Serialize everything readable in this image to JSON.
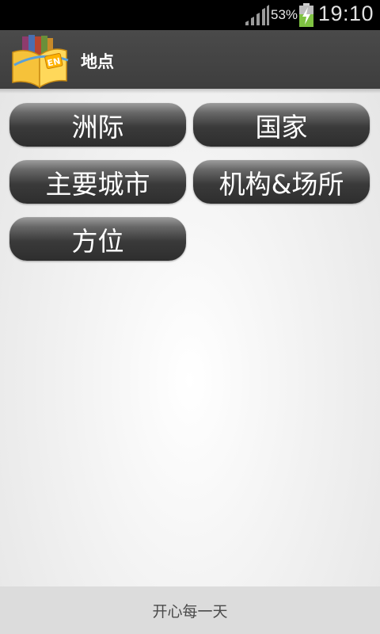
{
  "status_bar": {
    "battery_percent": "53%",
    "time": "19:10",
    "signal_icon": "signal-strength-icon",
    "battery_icon": "battery-charging-icon"
  },
  "action_bar": {
    "app_icon": "dictionary-book-icon",
    "icon_badge": "EN",
    "title": "地点"
  },
  "categories": [
    {
      "label": "洲际"
    },
    {
      "label": "国家"
    },
    {
      "label": "主要城市"
    },
    {
      "label": "机构&场所"
    },
    {
      "label": "方位"
    }
  ],
  "footer": {
    "text": "开心每一天"
  },
  "colors": {
    "status_bar": "#000000",
    "action_bar": "#444444",
    "button": "#3a3a3a",
    "footer": "#dcdcdc",
    "battery_fill": "#7fc242"
  }
}
